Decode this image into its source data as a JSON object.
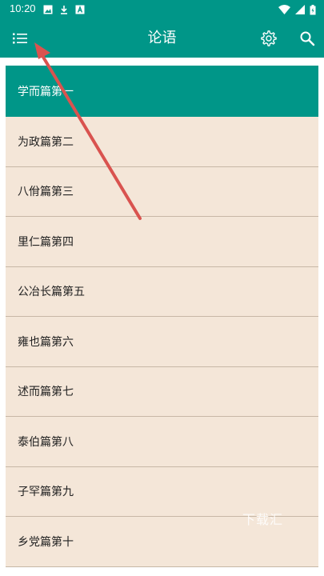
{
  "status_bar": {
    "time": "10:20",
    "left_icons": [
      "image-icon",
      "download-icon",
      "app-icon"
    ],
    "right_icons": [
      "wifi-icon",
      "signal-icon",
      "battery-icon"
    ]
  },
  "toolbar": {
    "title": "论语",
    "left_icon": "menu-list-icon",
    "right_icons": [
      "settings-icon",
      "search-icon"
    ],
    "color": "#009688"
  },
  "chapters": [
    {
      "label": "学而篇第一",
      "selected": true
    },
    {
      "label": "为政篇第二",
      "selected": false
    },
    {
      "label": "八佾篇第三",
      "selected": false
    },
    {
      "label": "里仁篇第四",
      "selected": false
    },
    {
      "label": "公冶长篇第五",
      "selected": false
    },
    {
      "label": "雍也篇第六",
      "selected": false
    },
    {
      "label": "述而篇第七",
      "selected": false
    },
    {
      "label": "泰伯篇第八",
      "selected": false
    },
    {
      "label": "子罕篇第九",
      "selected": false
    },
    {
      "label": "乡党篇第十",
      "selected": false
    }
  ],
  "colors": {
    "accent": "#009688",
    "list_background": "#f4e6d8",
    "divider": "#c7b7a6",
    "annotation_arrow": "#d9534f"
  },
  "watermark": "下载汇"
}
